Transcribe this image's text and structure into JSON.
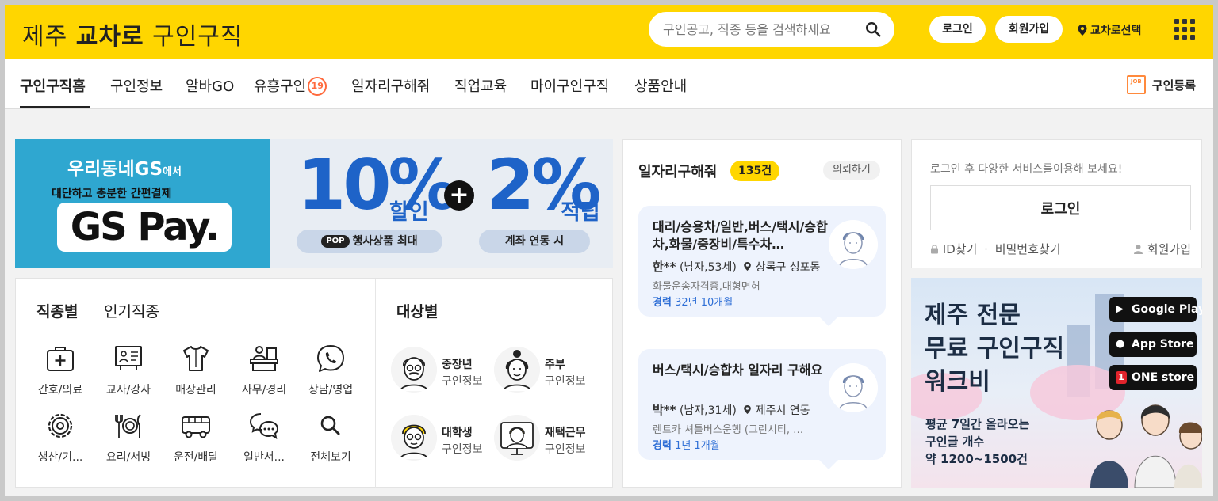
{
  "header": {
    "logo_prefix": "제주",
    "logo_bold": "교차로",
    "logo_suffix": "구인구직",
    "search_placeholder": "구인공고, 직종 등을 검색하세요",
    "login_label": "로그인",
    "join_label": "회원가입",
    "region_label": "교차로선택"
  },
  "nav": {
    "items": [
      "구인구직홈",
      "구인정보",
      "알바GO",
      "유흥구인",
      "일자리구해줘",
      "직업교육",
      "마이구인구직",
      "상품안내"
    ],
    "adult_badge": "19",
    "register_label": "구인등록",
    "job_icon_text": "JOB"
  },
  "banner": {
    "brand_line": "우리동네GS",
    "brand_suffix": "에서",
    "sub_line": "대단하고 충분한 간편결제",
    "pay_logo": "GS Pay.",
    "discount_value": "10%",
    "discount_unit": "할인",
    "plus": "+",
    "reward_value": "2%",
    "reward_unit": "적립",
    "tag1_badge": "POP",
    "tag1_text": "행사상품 최대",
    "tag2_text": "계좌 연동 시"
  },
  "categories": {
    "tab_active": "직종별",
    "tab_other": "인기직종",
    "items": [
      "간호/의료",
      "교사/강사",
      "매장관리",
      "사무/경리",
      "상담/영업",
      "생산/기...",
      "요리/서빙",
      "운전/배달",
      "일반서...",
      "전체보기"
    ],
    "target_title": "대상별",
    "targets": [
      {
        "line1": "중장년",
        "line2": "구인정보"
      },
      {
        "line1": "주부",
        "line2": "구인정보"
      },
      {
        "line1": "대학생",
        "line2": "구인정보"
      },
      {
        "line1": "재택근무",
        "line2": "구인정보"
      }
    ]
  },
  "seekers": {
    "title": "일자리구해줘",
    "count": "135건",
    "request_label": "의뢰하기",
    "cards": [
      {
        "headline": "대리/승용차/일반,버스/택시/승합차,화물/중장비/특수차…",
        "name": "한**",
        "info": "(남자,53세)",
        "location": "상록구 성포동",
        "cert": "화물운송자격증,대형면허",
        "exp_label": "경력",
        "exp_value": "32년 10개월"
      },
      {
        "headline": "버스/택시/승합차 일자리 구해요",
        "name": "박**",
        "info": "(남자,31세)",
        "location": "제주시 연동",
        "cert": "렌트카 셔틀버스운행 (그린시티, …",
        "exp_label": "경력",
        "exp_value": "1년 1개월"
      }
    ]
  },
  "login_panel": {
    "hint": "로그인 후 다양한 서비스를이용해 보세요!",
    "login_button": "로그인",
    "find_id": "ID찾기",
    "find_pw": "비밀번호찾기",
    "join": "회원가입"
  },
  "ad": {
    "line1": "제주 전문",
    "line2": "무료 구인구직",
    "line3": "워크비",
    "sub1": "평균 7일간 올라오는",
    "sub2": "구인글 개수",
    "sub3": "약 1200~1500건",
    "stores": [
      "Google Play",
      "App Store",
      "ONE store"
    ]
  },
  "colors": {
    "brand_yellow": "#ffd600",
    "accent_blue": "#1e63c8",
    "experience_blue": "#2f6fd6",
    "badge_orange": "#ff6a3d"
  }
}
